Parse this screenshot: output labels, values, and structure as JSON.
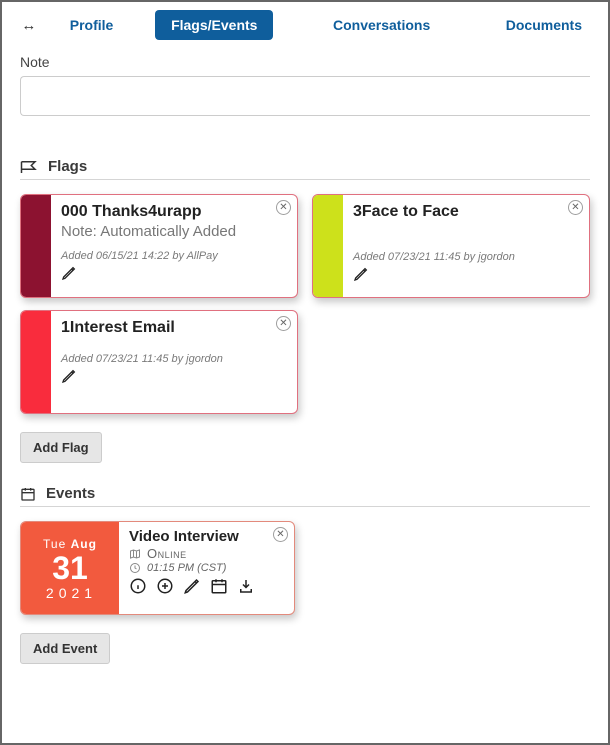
{
  "tabs": {
    "profile": "Profile",
    "flags_events": "Flags/Events",
    "conversations": "Conversations",
    "documents": "Documents"
  },
  "note": {
    "label": "Note",
    "value": ""
  },
  "sections": {
    "flags_title": "Flags",
    "events_title": "Events"
  },
  "flags": [
    {
      "color": "maroon",
      "title": "000 Thanks4urapp",
      "subtitle": "Note: Automatically Added",
      "meta": "Added 06/15/21 14:22 by AllPay"
    },
    {
      "color": "lime",
      "title": "3Face to Face",
      "subtitle": "",
      "meta": "Added 07/23/21 11:45 by jgordon"
    },
    {
      "color": "red",
      "title": "1Interest Email",
      "subtitle": "",
      "meta": "Added 07/23/21 11:45 by jgordon"
    }
  ],
  "buttons": {
    "add_flag": "Add Flag",
    "add_event": "Add Event"
  },
  "events": [
    {
      "dow": "Tue",
      "month": "Aug",
      "day": "31",
      "year": "2021",
      "title": "Video Interview",
      "location": "Online",
      "time": "01:15 PM (CST)"
    }
  ]
}
